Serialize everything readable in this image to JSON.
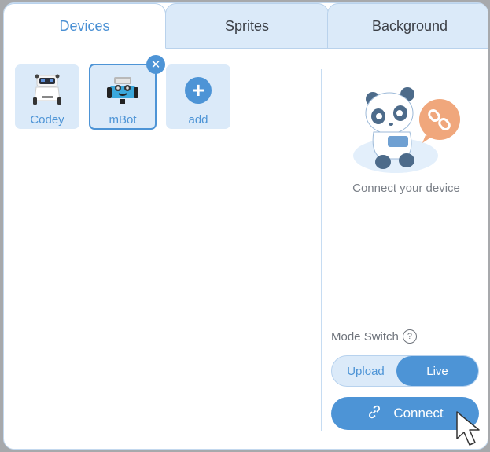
{
  "tabs": [
    {
      "label": "Devices",
      "active": true
    },
    {
      "label": "Sprites",
      "active": false
    },
    {
      "label": "Background",
      "active": false
    }
  ],
  "devices": [
    {
      "label": "Codey",
      "selected": false,
      "icon": "codey-robot-icon"
    },
    {
      "label": "mBot",
      "selected": true,
      "icon": "mbot-robot-icon",
      "remove_icon": "close-icon"
    },
    {
      "label": "add",
      "selected": false,
      "icon": "plus-icon"
    }
  ],
  "connection_panel": {
    "hint": "Connect your device",
    "illustration": "panda-disconnected-illustration",
    "mode_switch_label": "Mode Switch",
    "help_symbol": "?",
    "modes": [
      {
        "label": "Upload",
        "active": false
      },
      {
        "label": "Live",
        "active": true
      }
    ],
    "connect_label": "Connect",
    "connect_icon": "link-icon"
  },
  "colors": {
    "accent": "#4d94d6",
    "tab_inactive_bg": "#dbeaf9",
    "illustration_orange": "#f0a77c"
  }
}
